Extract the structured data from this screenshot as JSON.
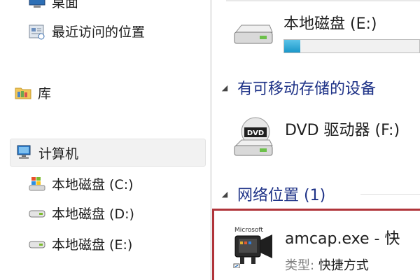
{
  "nav": {
    "desktop_label": "桌面",
    "recent_label": "最近访问的位置",
    "library_label": "库",
    "computer_label": "计算机",
    "drives": [
      {
        "label": "本地磁盘 (C:)"
      },
      {
        "label": "本地磁盘 (D:)"
      },
      {
        "label": "本地磁盘 (E:)"
      }
    ]
  },
  "main": {
    "drive_e": {
      "name": "本地磁盘 (E:)",
      "used_fraction": 0.12
    },
    "removable_header": "有可移动存储的设备",
    "dvd": {
      "name": "DVD 驱动器 (F:)",
      "icon_text": "DVD"
    },
    "network_header": "网络位置 (1)",
    "shortcut": {
      "name": "amcap.exe - 快",
      "type_label": "类型:",
      "type_value": "快捷方式",
      "icon_text": "Microsoft"
    }
  },
  "colors": {
    "accent_header": "#1e3287",
    "highlight_border": "#b0343a",
    "drive_bar": "#1a97c9"
  }
}
